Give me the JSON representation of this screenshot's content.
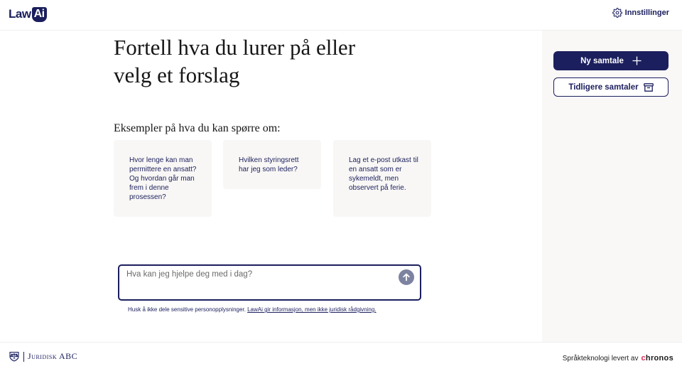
{
  "header": {
    "logo_part1": "Law",
    "logo_part2": "Ai",
    "settings_label": "Innstillinger"
  },
  "main": {
    "headline_line1": "Fortell hva du lurer på eller",
    "headline_line2": "velg et forslag",
    "examples_heading": "Eksempler på hva du kan spørre om:",
    "examples": [
      "Hvor lenge kan man permittere en ansatt? Og hvordan går man frem i denne prosessen?",
      "Hvilken styringsrett har jeg som leder?",
      "Lag et e-post utkast til en ansatt som er sykemeldt, men observert på ferie."
    ],
    "input": {
      "placeholder": "Hva kan jeg hjelpe deg med i dag?",
      "value": ""
    },
    "disclaimer_text": "Husk å ikke dele sensitive personopplysninger.",
    "disclaimer_link": "LawAi gir informasjon, men ikke juridisk rådgivning."
  },
  "sidebar": {
    "new_chat_label": "Ny samtale",
    "previous_chats_label": "Tidligere samtaler"
  },
  "footer": {
    "partner_logo_text": "Juridisk ABC",
    "credit_text": "Språkteknologi levert av",
    "credit_brand_first": "c",
    "credit_brand_rest": "hronos"
  },
  "colors": {
    "brand_navy": "#1c1f5e",
    "card_bg": "#f8f7f5",
    "sidebar_bg": "#f9f8f7",
    "send_button": "#7d82a0",
    "chronos_accent": "#e0284f"
  },
  "icons": {
    "settings": "gear-icon",
    "new_chat": "plus-icon",
    "previous_chats": "archive-box-icon",
    "send": "arrow-up-icon",
    "partner": "scales-shield-icon"
  }
}
